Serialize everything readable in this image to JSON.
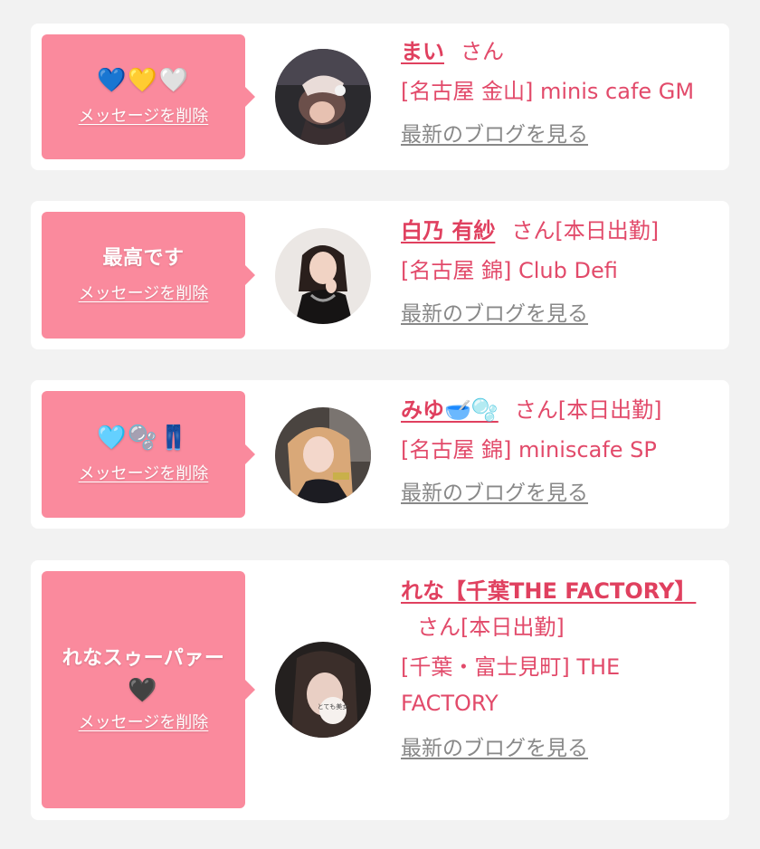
{
  "colors": {
    "background": "#f2f2f2",
    "card": "#ffffff",
    "bubble": "#fa8a9d",
    "accent": "#e24a6a",
    "link_gray": "#888888"
  },
  "cards": [
    {
      "message_icons": [
        "light-blue-heart-icon",
        "yellow-heart-icon",
        "white-heart-icon"
      ],
      "message_text": "💙💛🤍",
      "delete_label": "メッセージを削除",
      "name": "まい",
      "honorific": "さん",
      "store": "[名古屋 金山] minis cafe GM",
      "blog_label": "最新のブログを見る"
    },
    {
      "message_text": "最高です",
      "delete_label": "メッセージを削除",
      "name": "白乃 有紗",
      "honorific": "さん[本日出勤]",
      "store": "[名古屋 錦] Club Defi",
      "blog_label": "最新のブログを見る"
    },
    {
      "message_icons": [
        "light-blue-heart-icon",
        "bubbles-icon",
        "jeans-icon"
      ],
      "message_text": "🩵🫧👖",
      "delete_label": "メッセージを削除",
      "name": "みゆ🥣🫧",
      "honorific": "さん[本日出勤]",
      "store": "[名古屋 錦] miniscafe SP",
      "blog_label": "最新のブログを見る"
    },
    {
      "message_text": "れなスゥーパァー",
      "message_icons": [
        "black-heart-icon"
      ],
      "message_emoji": "🖤",
      "delete_label": "メッセージを削除",
      "name": "れな【千葉THE FACTORY】",
      "honorific": "さん[本日出勤]",
      "store": "[千葉・富士見町] THE FACTORY",
      "avatar_sticker": "とても美女",
      "blog_label": "最新のブログを見る"
    }
  ]
}
